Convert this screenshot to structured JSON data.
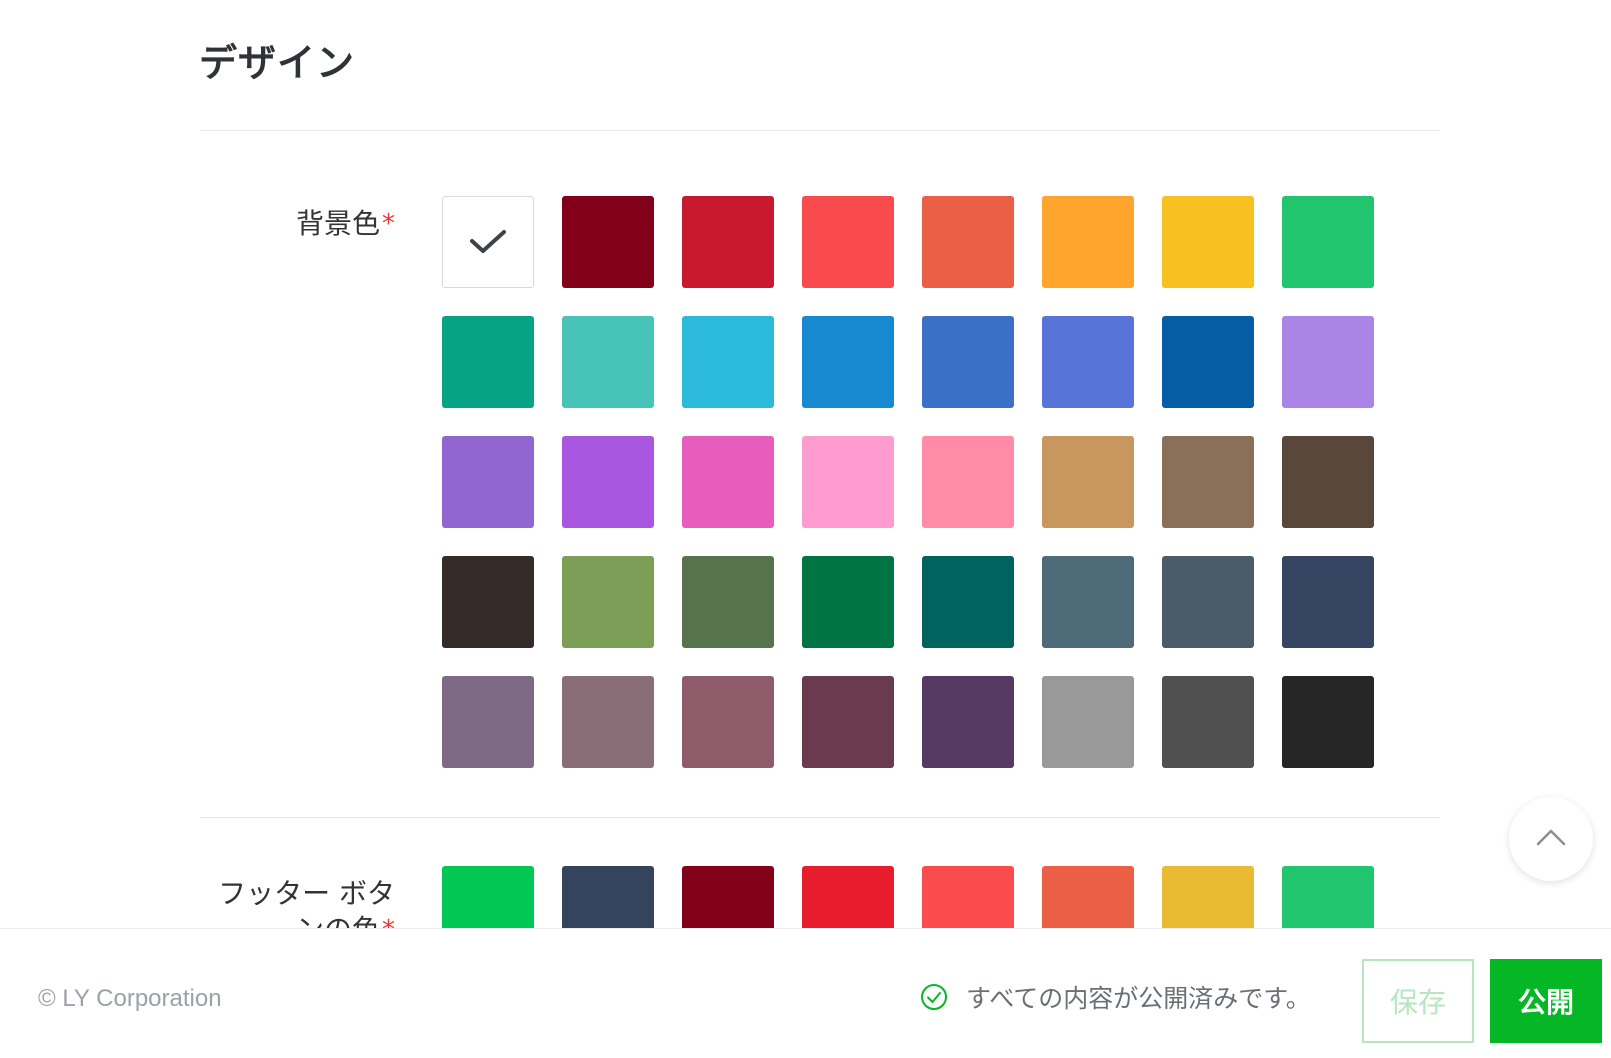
{
  "section": {
    "title": "デザイン"
  },
  "background_color": {
    "label": "背景色",
    "required_mark": "*",
    "selected": "#FFFFFF",
    "colors": [
      "#FFFFFF",
      "#82001A",
      "#C8192E",
      "#F94B4E",
      "#EB5F47",
      "#FFA52E",
      "#F7C121",
      "#20C56E",
      "#06A384",
      "#47C3B8",
      "#2CBADB",
      "#1789D0",
      "#3A70C5",
      "#5874D8",
      "#065EA6",
      "#AA84E6",
      "#9166D0",
      "#A855E0",
      "#E85CBC",
      "#FF9CCF",
      "#FF8BA6",
      "#C8975E",
      "#8A7058",
      "#5A473B",
      "#342B27",
      "#7C9E56",
      "#57734E",
      "#007443",
      "#00635E",
      "#4E6B79",
      "#4A5C68",
      "#364561",
      "#7E6A84",
      "#896E77",
      "#8E5C6A",
      "#6A3A4F",
      "#573A63",
      "#999999",
      "#505050",
      "#262626"
    ]
  },
  "footer_button_color": {
    "label": "フッター ボタンの色",
    "required_mark": "*",
    "colors": [
      "#02C755",
      "#34435E",
      "#82001A",
      "#E71D2D",
      "#FA4B4D",
      "#EB5F47",
      "#E8BB33",
      "#20C56E"
    ]
  },
  "footer": {
    "copyright": "© LY Corporation",
    "status": "すべての内容が公開済みです。",
    "save_label": "保存",
    "publish_label": "公開"
  },
  "icons": {
    "check": "check-icon",
    "scroll_top": "chevron-up-icon",
    "status": "check-circle-icon"
  }
}
